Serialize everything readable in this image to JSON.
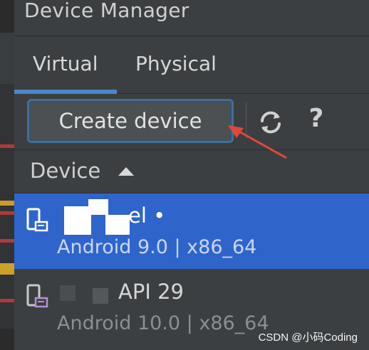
{
  "panel": {
    "title": "Device Manager"
  },
  "tabs": [
    {
      "label": "Virtual",
      "active": true
    },
    {
      "label": "Physical",
      "active": false
    }
  ],
  "toolbar": {
    "create_label": "Create device",
    "refresh_icon": "refresh-icon",
    "help_label": "?"
  },
  "table": {
    "column_header": "Device",
    "sort": "ascending"
  },
  "devices": [
    {
      "name": "el •",
      "subtitle": "Android 9.0 | x86_64",
      "selected": true
    },
    {
      "name": "API 29",
      "subtitle": "Android 10.0 | x86_64",
      "selected": false
    }
  ],
  "watermark": "CSDN @小码Coding",
  "colors": {
    "accent": "#4a88c7",
    "selection": "#2f65ca",
    "background": "#3c3f41",
    "annotation_arrow": "#e0483c"
  }
}
